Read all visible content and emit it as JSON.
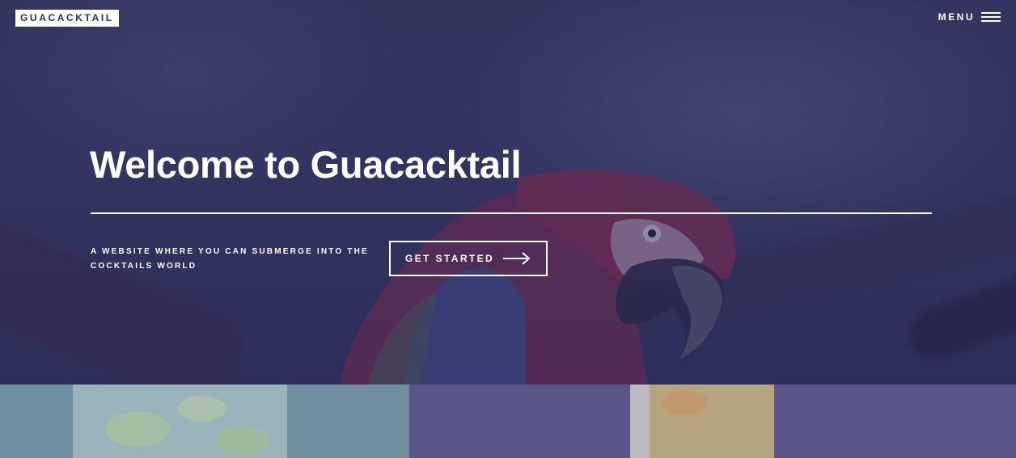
{
  "brand": {
    "logo_text": "GUACACKTAIL"
  },
  "nav": {
    "menu_label": "MENU",
    "menu_icon": "hamburger-icon"
  },
  "hero": {
    "title": "Welcome to Guacacktail",
    "tagline": "A WEBSITE WHERE YOU CAN SUBMERGE INTO THE COCKTAILS WORLD",
    "cta_label": "GET STARTED",
    "cta_icon": "arrow-right-icon",
    "background_image": "parrot-photo"
  },
  "cards": [
    {
      "image": "lime-cocktail-photo"
    },
    {
      "image": "orange-cocktail-photo"
    }
  ],
  "colors": {
    "overlay": "#2d3058",
    "logo_bg": "#ffffff",
    "text": "#ffffff",
    "card_left": "#8ea7b4",
    "card_right": "#5b5788"
  }
}
